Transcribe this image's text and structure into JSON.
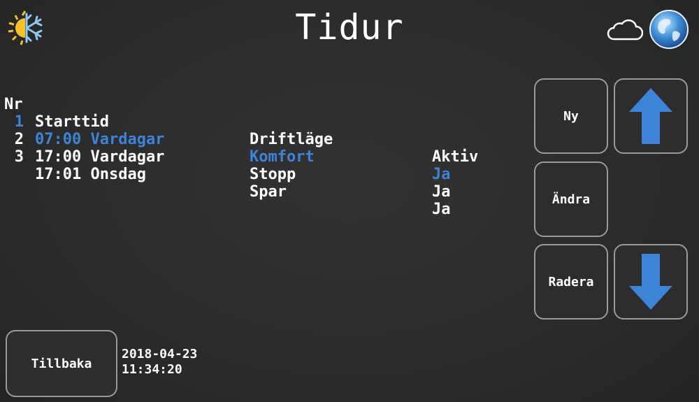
{
  "header": {
    "title": "Tidur",
    "icons": {
      "season": "sun-snowflake-icon",
      "cloud": "cloud-icon",
      "network": "globe-icon"
    }
  },
  "table": {
    "columns": {
      "nr": "Nr",
      "start": "Starttid",
      "mode": "Driftläge",
      "active": "Aktiv"
    },
    "rows": [
      {
        "nr": "1",
        "start": "07:00 Vardagar",
        "mode": "Komfort",
        "active": "Ja",
        "selected": true
      },
      {
        "nr": "2",
        "start": "17:00 Vardagar",
        "mode": "Stopp",
        "active": "Ja",
        "selected": false
      },
      {
        "nr": "3",
        "start": "17:01 Onsdag",
        "mode": "Spar",
        "active": "Ja",
        "selected": false
      }
    ]
  },
  "buttons": {
    "new": "Ny",
    "edit": "Ändra",
    "delete": "Radera",
    "back": "Tillbaka",
    "up_icon": "arrow-up-icon",
    "down_icon": "arrow-down-icon"
  },
  "status": {
    "date": "2018-04-23",
    "time": "11:34:20"
  },
  "colors": {
    "background": "#2b2b2c",
    "selected_row": "#3d84d8",
    "arrow": "#3d84d8",
    "button_border": "#9a9a9a",
    "text": "#ffffff"
  }
}
